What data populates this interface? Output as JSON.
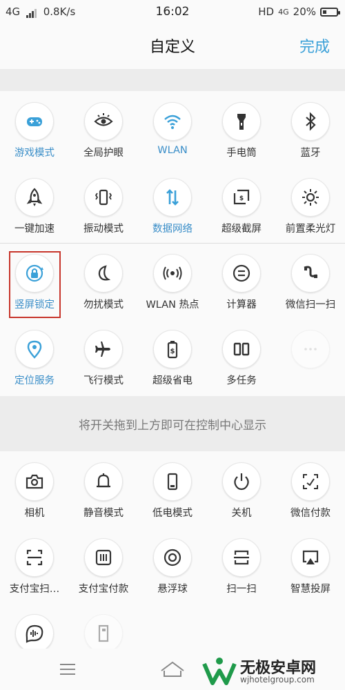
{
  "status_bar": {
    "network": "4G",
    "speed": "0.8K/s",
    "time": "16:02",
    "hd": "HD",
    "net2": "4G",
    "battery": "20%"
  },
  "header": {
    "title": "自定义",
    "done_label": "完成"
  },
  "accent_color": "#3aa0d8",
  "highlight_color": "#c7342a",
  "active_tiles": [
    {
      "label": "游戏模式",
      "icon": "gamepad-icon",
      "active": true
    },
    {
      "label": "全局护眼",
      "icon": "eye-icon",
      "active": false
    },
    {
      "label": "WLAN",
      "icon": "wifi-icon",
      "active": true
    },
    {
      "label": "手电筒",
      "icon": "flashlight-icon",
      "active": false
    },
    {
      "label": "蓝牙",
      "icon": "bluetooth-icon",
      "active": false
    },
    {
      "label": "一键加速",
      "icon": "rocket-icon",
      "active": false
    },
    {
      "label": "振动模式",
      "icon": "vibrate-icon",
      "active": false
    },
    {
      "label": "数据网络",
      "icon": "data-arrows-icon",
      "active": true
    },
    {
      "label": "超级截屏",
      "icon": "screenshot-icon",
      "active": false
    },
    {
      "label": "前置柔光灯",
      "icon": "sun-icon",
      "active": false
    },
    {
      "label": "竖屏锁定",
      "icon": "rotation-lock-icon",
      "active": true
    },
    {
      "label": "勿扰模式",
      "icon": "moon-icon",
      "active": false
    },
    {
      "label": "WLAN 热点",
      "icon": "hotspot-icon",
      "active": false
    },
    {
      "label": "计算器",
      "icon": "calculator-icon",
      "active": false
    },
    {
      "label": "微信扫一扫",
      "icon": "wechat-scan-icon",
      "active": false
    },
    {
      "label": "定位服务",
      "icon": "location-icon",
      "active": true
    },
    {
      "label": "飞行模式",
      "icon": "airplane-icon",
      "active": false
    },
    {
      "label": "超级省电",
      "icon": "battery-saver-icon",
      "active": false
    },
    {
      "label": "多任务",
      "icon": "multitask-icon",
      "active": false
    },
    {
      "label": "",
      "icon": "more-dots-icon",
      "active": false
    }
  ],
  "hint": "将开关拖到上方即可在控制中心显示",
  "inactive_tiles": [
    {
      "label": "相机",
      "icon": "camera-icon"
    },
    {
      "label": "静音模式",
      "icon": "bell-icon"
    },
    {
      "label": "低电模式",
      "icon": "phone-battery-icon"
    },
    {
      "label": "关机",
      "icon": "power-icon"
    },
    {
      "label": "微信付款",
      "icon": "wechat-pay-icon"
    },
    {
      "label": "支付宝扫…",
      "icon": "alipay-scan-icon"
    },
    {
      "label": "支付宝付款",
      "icon": "alipay-pay-icon"
    },
    {
      "label": "悬浮球",
      "icon": "float-ball-icon"
    },
    {
      "label": "扫一扫",
      "icon": "scan-icon"
    },
    {
      "label": "智慧投屏",
      "icon": "screen-cast-icon"
    },
    {
      "label": "",
      "icon": "voice-icon"
    },
    {
      "label": "",
      "icon": "sd-card-icon"
    }
  ],
  "watermark": {
    "title": "无极安卓网",
    "url": "wjhotelgroup.com"
  }
}
